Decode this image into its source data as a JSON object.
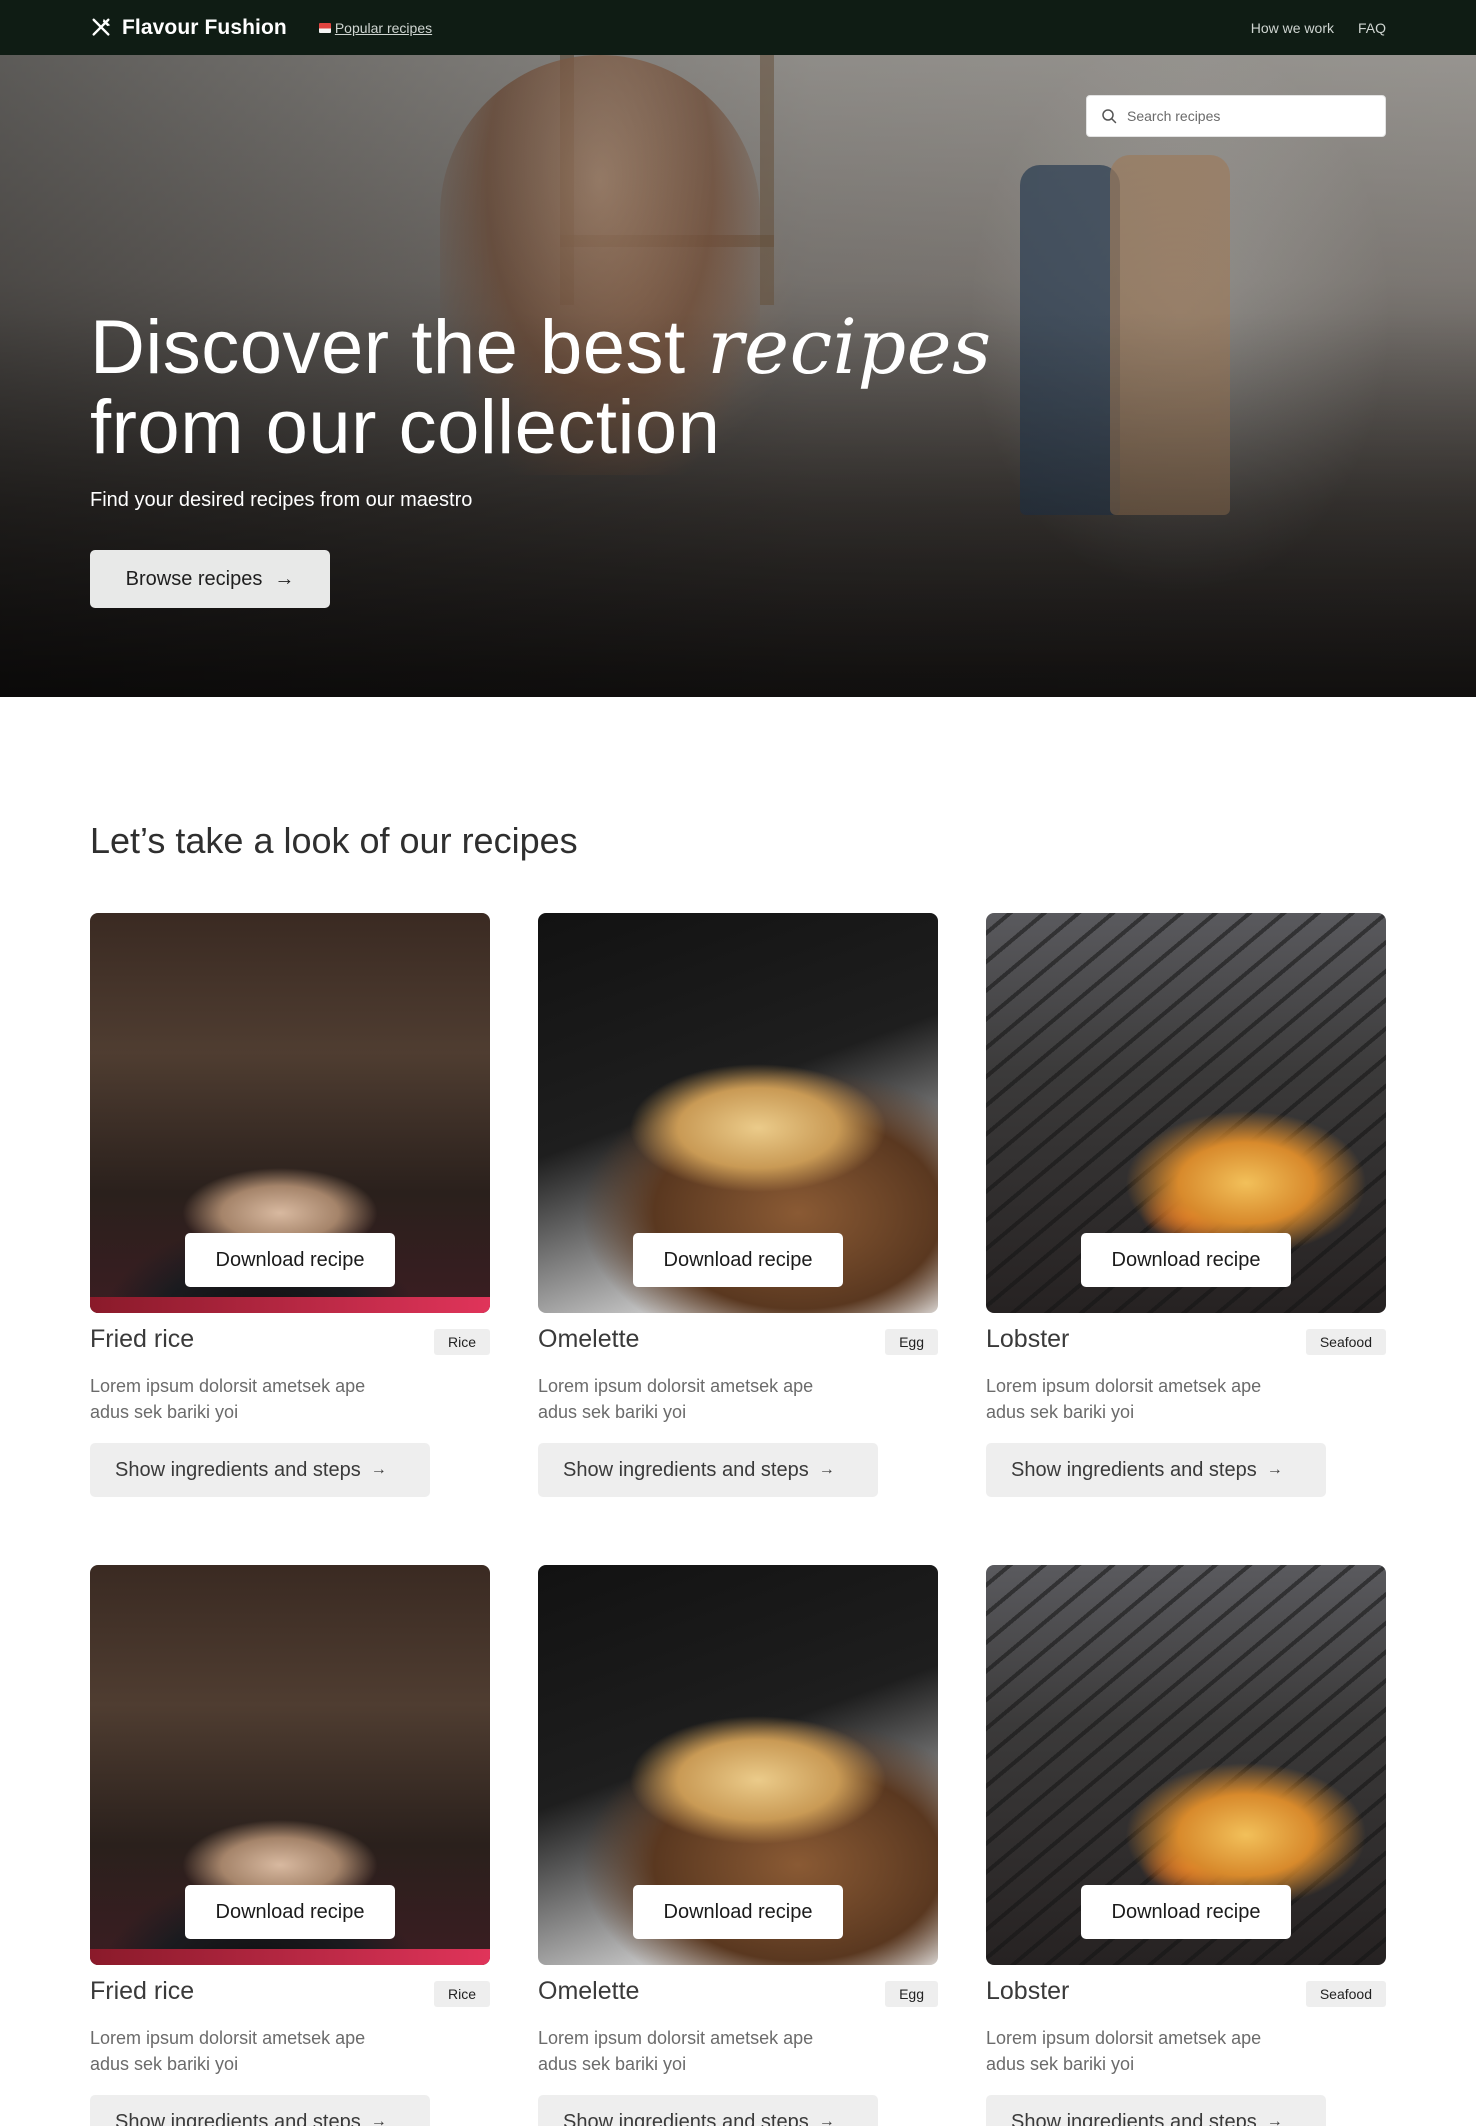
{
  "nav": {
    "brand": "Flavour Fushion",
    "popular": "Popular recipes",
    "links": [
      "How we work",
      "FAQ"
    ]
  },
  "search": {
    "placeholder": "Search recipes"
  },
  "hero": {
    "title_line1": "Discover the best ",
    "title_em": "recipes",
    "title_line2": "from our collection",
    "subtitle": "Find your desired recipes from our maestro",
    "cta": "Browse recipes",
    "cta_arrow": "→"
  },
  "section": {
    "title": "Let’s take a look of our recipes"
  },
  "cards": [
    {
      "name": "Fried rice",
      "tag": "Rice",
      "download": "Download recipe",
      "desc": "Lorem ipsum dolorsit ametsek ape adus sek bariki yoi",
      "button": "Show ingredients and steps",
      "arrow": "→"
    },
    {
      "name": "Omelette",
      "tag": "Egg",
      "download": "Download recipe",
      "desc": "Lorem ipsum dolorsit ametsek ape adus sek bariki yoi",
      "button": "Show ingredients and steps",
      "arrow": "→"
    },
    {
      "name": "Lobster",
      "tag": "Seafood",
      "download": "Download recipe",
      "desc": "Lorem ipsum dolorsit ametsek ape adus sek bariki yoi",
      "button": "Show ingredients and steps",
      "arrow": "→"
    },
    {
      "name": "Fried rice",
      "tag": "Rice",
      "download": "Download recipe",
      "desc": "Lorem ipsum dolorsit ametsek ape adus sek bariki yoi",
      "button": "Show ingredients and steps",
      "arrow": "→"
    },
    {
      "name": "Omelette",
      "tag": "Egg",
      "download": "Download recipe",
      "desc": "Lorem ipsum dolorsit ametsek ape adus sek bariki yoi",
      "button": "Show ingredients and steps",
      "arrow": "→"
    },
    {
      "name": "Lobster",
      "tag": "Seafood",
      "download": "Download recipe",
      "desc": "Lorem ipsum dolorsit ametsek ape adus sek bariki yoi",
      "button": "Show ingredients and steps",
      "arrow": "→"
    }
  ],
  "colors": {
    "nav_bg": "#0f1c14",
    "button_gray": "#eeeeee"
  }
}
